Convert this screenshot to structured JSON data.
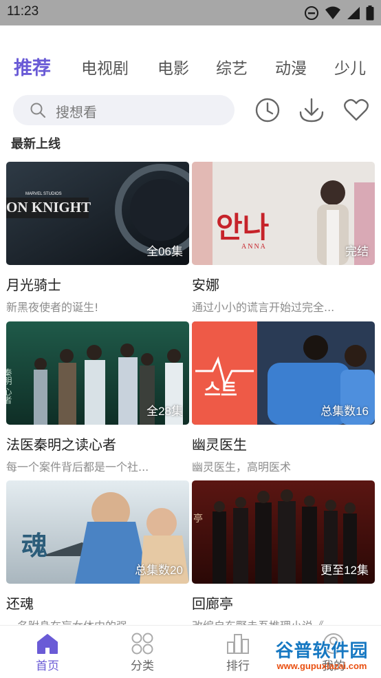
{
  "status_bar": {
    "time": "11:23"
  },
  "tabs": [
    {
      "label": "推荐",
      "active": true
    },
    {
      "label": "电视剧"
    },
    {
      "label": "电影"
    },
    {
      "label": "综艺"
    },
    {
      "label": "动漫"
    },
    {
      "label": "少儿"
    }
  ],
  "search": {
    "placeholder": "搜想看"
  },
  "section": {
    "title": "最新上线"
  },
  "cards": [
    {
      "title": "月光骑士",
      "desc": "新黑夜使者的诞生!",
      "badge": "全06集",
      "poster_text": "ON KNIGHT",
      "poster_brand": "MARVEL STUDIOS"
    },
    {
      "title": "安娜",
      "desc": "通过小小的谎言开始过完全...",
      "badge": "完结",
      "poster_text": "안나",
      "poster_sub": "ANNA"
    },
    {
      "title": "法医秦明之读心者",
      "desc": "每一个案件背后都是一个社...",
      "badge": "全28集",
      "poster_text": "秦明 心者"
    },
    {
      "title": "幽灵医生",
      "desc": "幽灵医生，高明医术",
      "badge": "总集数16",
      "poster_text": "스트"
    },
    {
      "title": "还魂",
      "desc": "一名附身在盲女体内的强...",
      "badge": "总集数20",
      "poster_text": "魂"
    },
    {
      "title": "回廊亭",
      "desc": "改编自东野圭吾推理小说《...",
      "badge": "更至12集",
      "poster_text": "亭"
    }
  ],
  "bottom_nav": [
    {
      "label": "首页",
      "icon": "home-icon",
      "active": true
    },
    {
      "label": "分类",
      "icon": "category-icon"
    },
    {
      "label": "排行",
      "icon": "ranking-icon"
    },
    {
      "label": "我的",
      "icon": "profile-icon"
    }
  ],
  "watermark": {
    "name": "谷普软件园",
    "url": "www.gupuxiazai.com"
  },
  "colors": {
    "accent": "#6a5bd6",
    "status_bar": "#a7a7a7"
  }
}
